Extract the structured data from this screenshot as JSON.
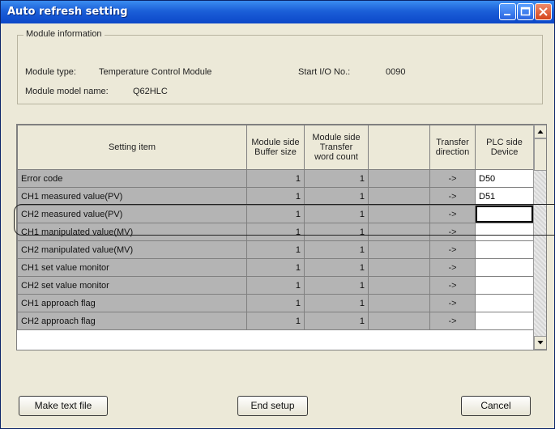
{
  "window": {
    "title": "Auto refresh setting"
  },
  "module_info": {
    "group_label": "Module information",
    "type_label": "Module type:",
    "type_value": "Temperature Control Module",
    "start_io_label": "Start I/O No.:",
    "start_io_value": "0090",
    "model_label": "Module model name:",
    "model_value": "Q62HLC"
  },
  "table": {
    "headers": {
      "setting_item": "Setting item",
      "buffer_size_1": "Module side",
      "buffer_size_2": "Buffer size",
      "transfer_count_1": "Module side",
      "transfer_count_2": "Transfer",
      "transfer_count_3": "word count",
      "direction_1": "Transfer",
      "direction_2": "direction",
      "device_1": "PLC side",
      "device_2": "Device"
    },
    "rows": [
      {
        "item": "Error code",
        "buffer": "1",
        "count": "1",
        "dir": "->",
        "device": "D50"
      },
      {
        "item": "CH1 measured value(PV)",
        "buffer": "1",
        "count": "1",
        "dir": "->",
        "device": "D51"
      },
      {
        "item": "CH2 measured value(PV)",
        "buffer": "1",
        "count": "1",
        "dir": "->",
        "device": ""
      },
      {
        "item": "CH1 manipulated value(MV)",
        "buffer": "1",
        "count": "1",
        "dir": "->",
        "device": ""
      },
      {
        "item": "CH2 manipulated value(MV)",
        "buffer": "1",
        "count": "1",
        "dir": "->",
        "device": ""
      },
      {
        "item": "CH1 set value monitor",
        "buffer": "1",
        "count": "1",
        "dir": "->",
        "device": ""
      },
      {
        "item": "CH2 set value monitor",
        "buffer": "1",
        "count": "1",
        "dir": "->",
        "device": ""
      },
      {
        "item": "CH1 approach flag",
        "buffer": "1",
        "count": "1",
        "dir": "->",
        "device": ""
      },
      {
        "item": "CH2 approach flag",
        "buffer": "1",
        "count": "1",
        "dir": "->",
        "device": ""
      }
    ]
  },
  "buttons": {
    "make_text_file": "Make text file",
    "end_setup": "End setup",
    "cancel": "Cancel"
  }
}
